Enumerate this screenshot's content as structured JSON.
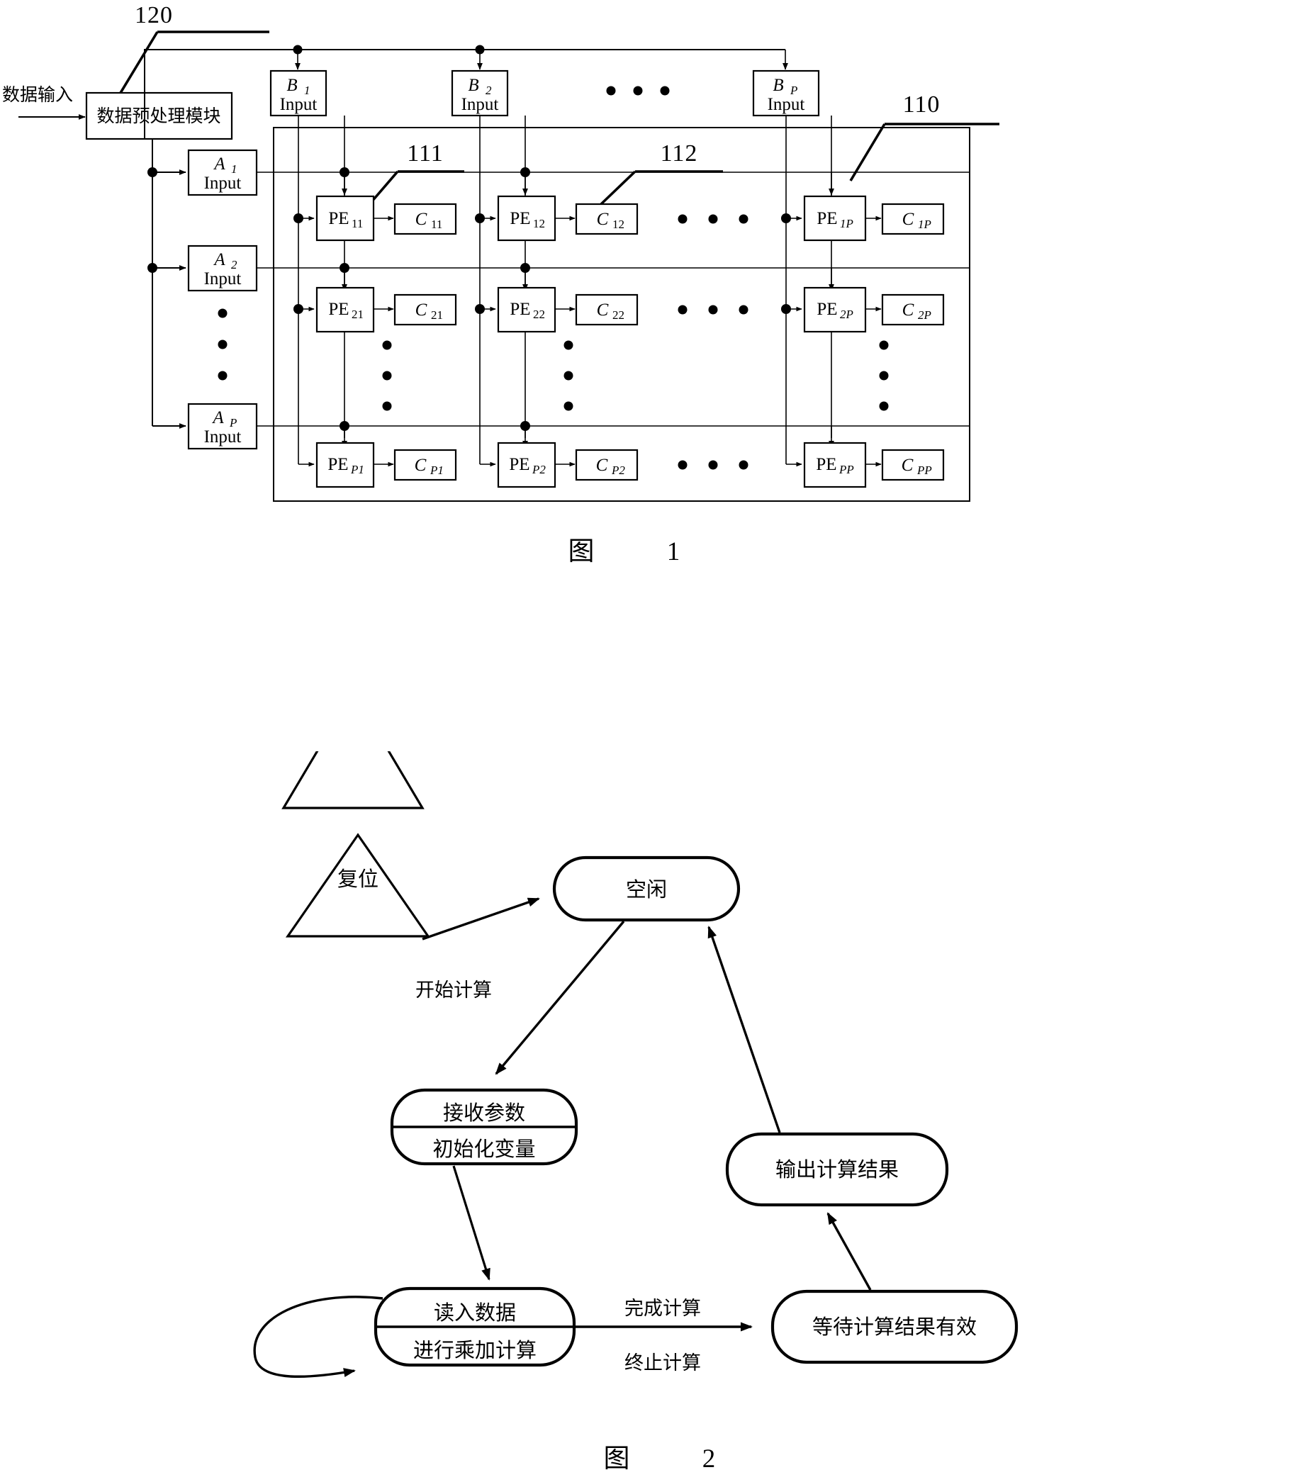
{
  "document": {
    "type": "patent-drawing-sheet",
    "language": "zh-CN"
  },
  "figure1": {
    "caption_label": "图",
    "caption_number": "1",
    "reference_numerals": {
      "preprocess_module": "120",
      "pe_array": "110",
      "pe_element": "111",
      "c_element": "112"
    },
    "input_signal_label": "数据输入",
    "preprocess_module_label": "数据预处理模块",
    "b_inputs": [
      {
        "name": "B",
        "sub": "1",
        "line2": "Input"
      },
      {
        "name": "B",
        "sub": "2",
        "line2": "Input"
      },
      {
        "name": "B",
        "sub": "P",
        "line2": "Input"
      }
    ],
    "a_inputs": [
      {
        "name": "A",
        "sub": "1",
        "line2": "Input"
      },
      {
        "name": "A",
        "sub": "2",
        "line2": "Input"
      },
      {
        "name": "A",
        "sub": "P",
        "line2": "Input"
      }
    ],
    "pe_rows": [
      {
        "cells": [
          {
            "pe": "PE",
            "pe_sub": "11",
            "c": "C",
            "c_sub": "11"
          },
          {
            "pe": "PE",
            "pe_sub": "12",
            "c": "C",
            "c_sub": "12"
          },
          {
            "pe": "PE",
            "pe_sub": "1P",
            "c": "C",
            "c_sub": "1P"
          }
        ]
      },
      {
        "cells": [
          {
            "pe": "PE",
            "pe_sub": "21",
            "c": "C",
            "c_sub": "21"
          },
          {
            "pe": "PE",
            "pe_sub": "22",
            "c": "C",
            "c_sub": "22"
          },
          {
            "pe": "PE",
            "pe_sub": "2P",
            "c": "C",
            "c_sub": "2P"
          }
        ]
      },
      {
        "cells": [
          {
            "pe": "PE",
            "pe_sub": "P1",
            "c": "C",
            "c_sub": "P1"
          },
          {
            "pe": "PE",
            "pe_sub": "P2",
            "c": "C",
            "c_sub": "P2"
          },
          {
            "pe": "PE",
            "pe_sub": "PP",
            "c": "C",
            "c_sub": "PP"
          }
        ]
      }
    ],
    "ellipsis_marker": "•"
  },
  "figure2": {
    "caption_label": "图",
    "caption_number": "2",
    "start_node_label": "复位",
    "states": [
      {
        "id": "idle",
        "line1": "空闲",
        "line2": ""
      },
      {
        "id": "recv",
        "line1": "接收参数",
        "line2": "初始化变量"
      },
      {
        "id": "compute",
        "line1": "读入数据",
        "line2": "进行乘加计算"
      },
      {
        "id": "wait",
        "line1": "等待计算结果有效",
        "line2": ""
      },
      {
        "id": "output",
        "line1": "输出计算结果",
        "line2": ""
      }
    ],
    "transitions": [
      {
        "from": "reset",
        "to": "idle",
        "label": ""
      },
      {
        "from": "idle",
        "to": "recv",
        "label": "开始计算"
      },
      {
        "from": "recv",
        "to": "compute",
        "label": ""
      },
      {
        "from": "compute",
        "to": "compute",
        "label": ""
      },
      {
        "from": "compute",
        "to": "wait",
        "label": "完成计算"
      },
      {
        "from": "compute",
        "to": "wait",
        "label2": "终止计算"
      },
      {
        "from": "wait",
        "to": "output",
        "label": ""
      },
      {
        "from": "output",
        "to": "idle",
        "label": ""
      }
    ],
    "edge_labels": {
      "start_calc": "开始计算",
      "finish_calc": "完成计算",
      "abort_calc": "终止计算"
    }
  },
  "colors": {
    "ink": "#000000",
    "paper": "#ffffff"
  }
}
